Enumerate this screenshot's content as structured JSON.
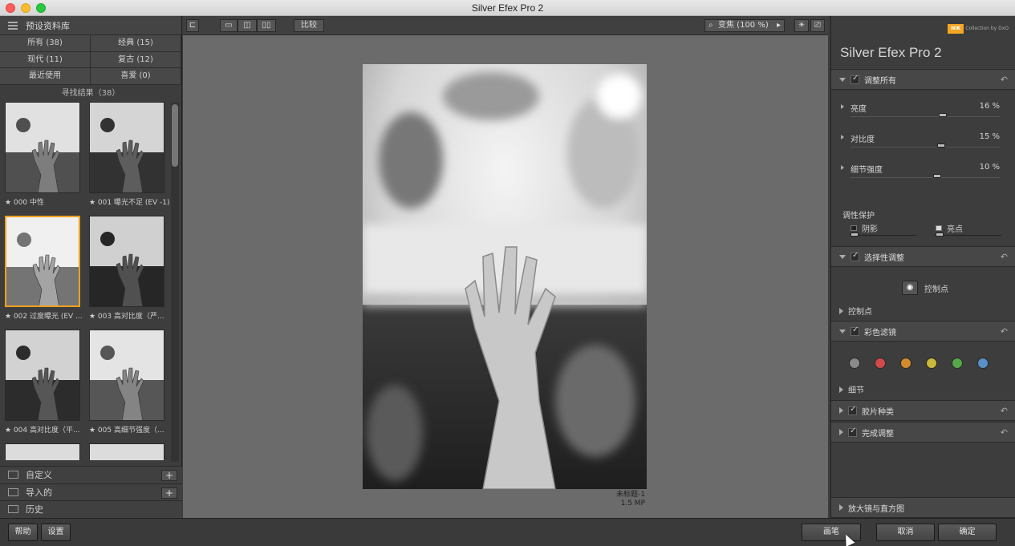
{
  "window": {
    "title": "Silver Efex Pro 2"
  },
  "left_panel": {
    "header": "预设资料库",
    "categories": [
      "所有 (38)",
      "经典 (15)",
      "现代 (11)",
      "复古 (12)",
      "最近使用",
      "喜爱 (0)"
    ],
    "results_label": "寻找结果（38）",
    "presets": [
      {
        "label": "★ 000 中性",
        "selected": false
      },
      {
        "label": "★ 001 曝光不足 (EV -1)",
        "selected": false
      },
      {
        "label": "★ 002 过度曝光 (EV ...",
        "selected": true
      },
      {
        "label": "★ 003 高对比度（严...",
        "selected": false
      },
      {
        "label": "★ 004 高对比度（平...",
        "selected": false
      },
      {
        "label": "★ 005 高细节强度（...",
        "selected": false
      }
    ],
    "footer": [
      "自定义",
      "导入的",
      "历史"
    ]
  },
  "toolbar": {
    "compare": "比较",
    "zoom": "变焦 (100 %)"
  },
  "image_info": {
    "name": "未标题-1",
    "size": "1.5 MP"
  },
  "right_panel": {
    "brand_logo": "NIK",
    "brand": "Collection by DxO",
    "title": "Silver Efex Pro 2",
    "sections": {
      "adjust_all": "调整所有",
      "sliders": [
        {
          "label": "亮度",
          "value": "16 %",
          "pos": 0.62
        },
        {
          "label": "对比度",
          "value": "15 %",
          "pos": 0.61
        },
        {
          "label": "细节强度",
          "value": "10 %",
          "pos": 0.58
        }
      ],
      "tonal_protection": "调性保护",
      "shadows": "阴影",
      "highlights": "亮点",
      "selective": "选择性调整",
      "control_point_btn": "控制点",
      "control_points": "控制点",
      "color_filter": "彩色滤镜",
      "color_filters": [
        "#8a8a8a",
        "#d04a4a",
        "#d48a2e",
        "#c9b83a",
        "#56a84a",
        "#5a8fc9"
      ],
      "details": "细节",
      "film_type": "胶片种类",
      "finishing": "完成调整",
      "loupe": "放大镜与直方图"
    }
  },
  "bottom": {
    "help": "帮助",
    "settings": "设置",
    "brush": "画笔",
    "cancel": "取消",
    "ok": "确定"
  }
}
